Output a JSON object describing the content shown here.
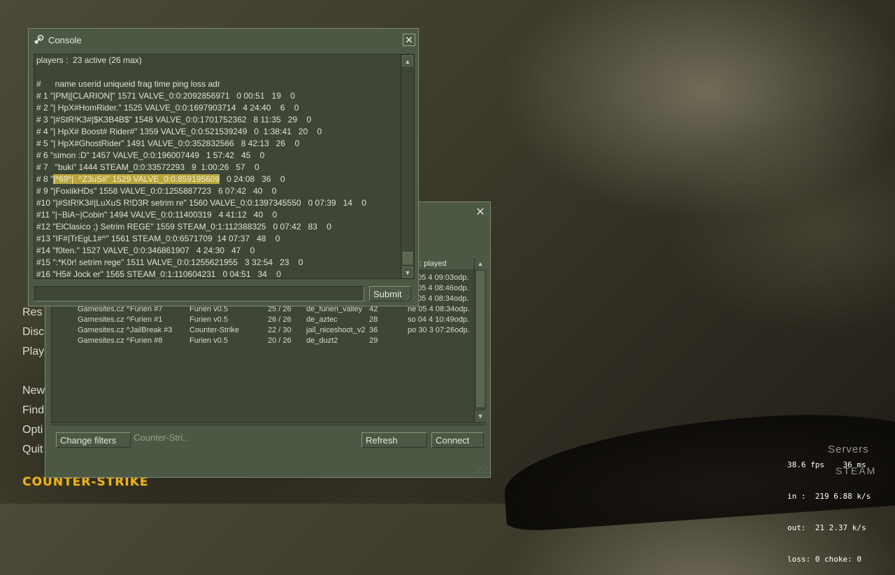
{
  "main_menu": {
    "items": [
      "Resume Game",
      "Disconnect",
      "Play CD",
      "New Game",
      "Find Servers",
      "Options",
      "Quit"
    ],
    "visible_labels": [
      "Res",
      "Disc",
      "Play",
      "New",
      "Find",
      "Opti",
      "Quit"
    ]
  },
  "logo": {
    "text": "COUNTER-STRIKE"
  },
  "server_browser": {
    "column_header_last_played": "Last played",
    "column_header_visible": ": played",
    "rows": [
      {
        "name": "",
        "game": "",
        "players": "",
        "map": "",
        "latency": "",
        "last_played": "05 4 09:03odp."
      },
      {
        "name": "",
        "game": "",
        "players": "",
        "map": "",
        "latency": "",
        "last_played": "05 4 08:46odp."
      },
      {
        "name": "",
        "game": "",
        "players": "",
        "map": "",
        "latency": "",
        "last_played": "05 4 08:34odp."
      },
      {
        "name": "Gamesites.cz ^Furien #7",
        "game": "Furien v0.5",
        "players": "25 / 26",
        "map": "de_furien_valley",
        "latency": "42",
        "last_played": "ne 05 4 08:34odp."
      },
      {
        "name": "Gamesites.cz ^Furien #1",
        "game": "Furien v0.5",
        "players": "26 / 26",
        "map": "de_aztec",
        "latency": "28",
        "last_played": "so 04 4 10:49odp."
      },
      {
        "name": "Gamesites.cz ^JailBreak #3",
        "game": "Counter-Strike",
        "players": "22 / 30",
        "map": "jail_niceshoot_v2",
        "latency": "36",
        "last_played": "po 30 3 07:26odp."
      },
      {
        "name": "Gamesites.cz ^Furien #8",
        "game": "Furien v0.5",
        "players": "20 / 26",
        "map": "de_duzt2",
        "latency": "29",
        "last_played": ""
      }
    ],
    "buttons": {
      "change_filters": "Change filters",
      "filter_summary": "Counter-Stri..",
      "refresh": "Refresh",
      "connect": "Connect"
    },
    "close_glyph": "✕"
  },
  "console": {
    "title": "Console",
    "close_glyph": "✕",
    "lines": [
      "players :  23 active (26 max)",
      "",
      "#      name userid uniqueid frag time ping loss adr",
      "# 1 \"|PM|[CLARION]\" 1571 VALVE_0:0:2092856971   0 00:51   19    0",
      "# 2 \"| HpX#HomRider.\" 1525 VALVE_0:0:1697903714   4 24:40    6    0",
      "# 3 \"|#StR!K3#|$K3B4B$\" 1548 VALVE_0:0:1701752362   8 11:35   29    0",
      "# 4 \"| HpX# Boost# Rider#\" 1359 VALVE_0:0:521539249   0  1:38:41   20    0",
      "# 5 \"| HpX#GhostRider\" 1491 VALVE_0:0:352832566   8 42:13   26    0",
      "# 6 \"simon :D\" 1457 VALVE_0:0:196007449   1 57:42   45    0",
      "# 7   \"buki\" 1444 STEAM_0:0:33572293   9  1:00:26   57    0",
      "",
      "# 9 \"|FoxiikHDs\" 1558 VALVE_0:0:1255887723   6 07:42   40    0",
      "#10 \"|#StR!K3#|LuXuS R!D3R setrim re\" 1560 VALVE_0:0:1397345550   0 07:39   14    0",
      "#11 \"|~BiA~|Cobin\" 1494 VALVE_0:0:11400319   4 41:12   40    0",
      "#12 \"ElClasico ;) Setrim REGE\" 1559 STEAM_0:1:112388325   0 07:42   83    0",
      "#13 \"IF#|TrEgL1#^\" 1561 STEAM_0:0:6571709  14 07:37   48    0",
      "#14 \"f0ten.\" 1527 VALVE_0:0:346861907   4 24:30   47    0",
      "#15 \":*K0r! setrim rege\" 1511 VALVE_0:0:1255621955   3 32:54   23    0",
      "#16 \"H5# Jock er\" 1565 STEAM_0:1:110604231   0 04:51   34    0"
    ],
    "line8_prefix": "# 8 \"",
    "line8_highlight": "|*69*|  ^Z3uS#\" 1529 VALVE_0:0:859195609",
    "line8_suffix": "   0 24:08   36    0",
    "input_value": "",
    "submit_label": "Submit"
  },
  "net_graph": {
    "fps": "38.6 fps",
    "ms": "36 ms",
    "in": "in :  219 6.88 k/s",
    "out": "out:  21 2.37 k/s",
    "loss": "loss: 0 choke: 0",
    "overlay_servers": "Servers",
    "overlay_steam": "STEAM"
  }
}
